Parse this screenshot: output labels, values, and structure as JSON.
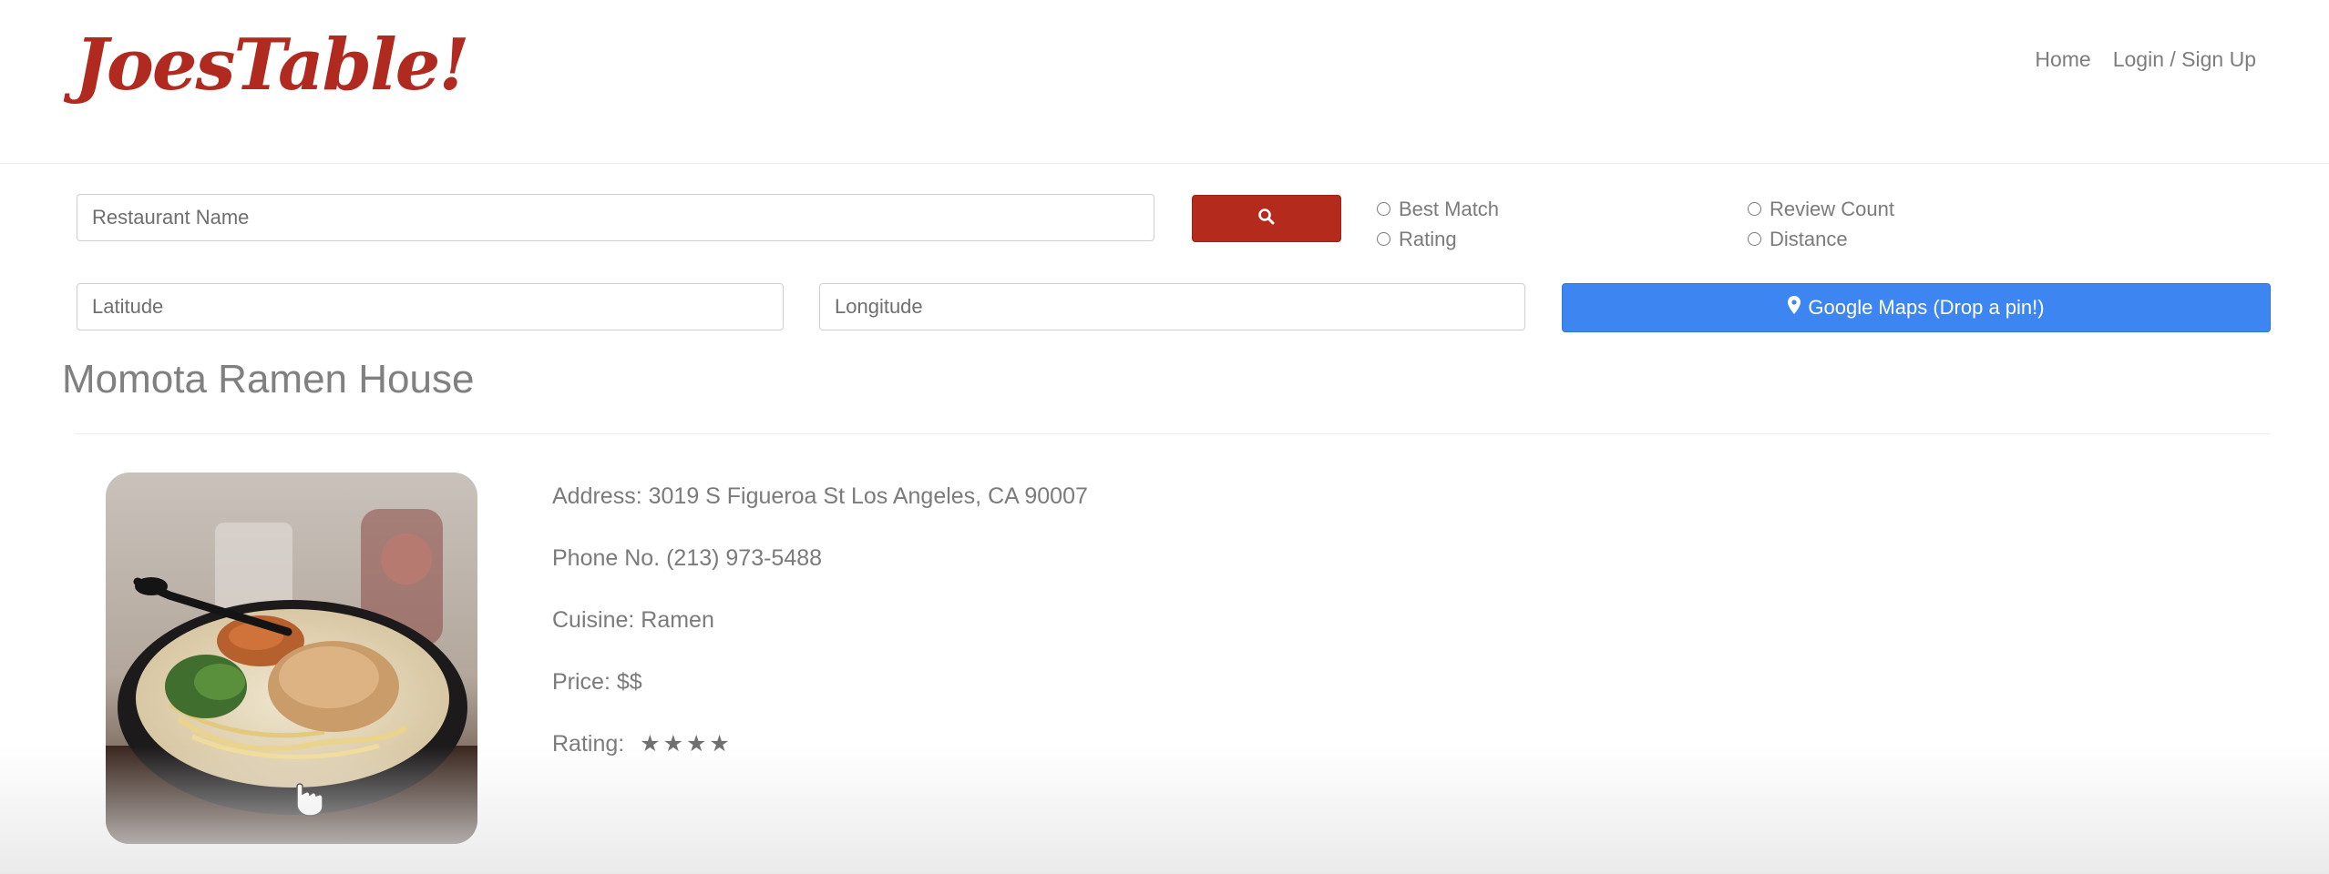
{
  "header": {
    "logo": "JoesTable!",
    "nav": [
      {
        "label": "Home"
      },
      {
        "label": "Login / Sign Up"
      }
    ]
  },
  "search": {
    "name_placeholder": "Restaurant Name",
    "latitude_placeholder": "Latitude",
    "longitude_placeholder": "Longitude",
    "search_icon": "search-icon",
    "sort_options": [
      {
        "label": "Best Match"
      },
      {
        "label": "Rating"
      },
      {
        "label": "Review Count"
      },
      {
        "label": "Distance"
      }
    ],
    "maps_label": "Google Maps (Drop a pin!)",
    "maps_icon": "map-marker-icon"
  },
  "restaurant": {
    "name": "Momota Ramen House",
    "address": "Address: 3019 S Figueroa St Los Angeles, CA 90007",
    "phone": "Phone No. (213) 973-5488",
    "cuisine": "Cuisine: Ramen",
    "price": "Price: $$",
    "rating_label": "Rating:",
    "rating_stars": "★★★★",
    "rating_value": 4
  },
  "colors": {
    "brand": "#b02a1f",
    "search_button": "#b42b1d",
    "maps_button": "#3d85f0",
    "text": "#777777"
  }
}
